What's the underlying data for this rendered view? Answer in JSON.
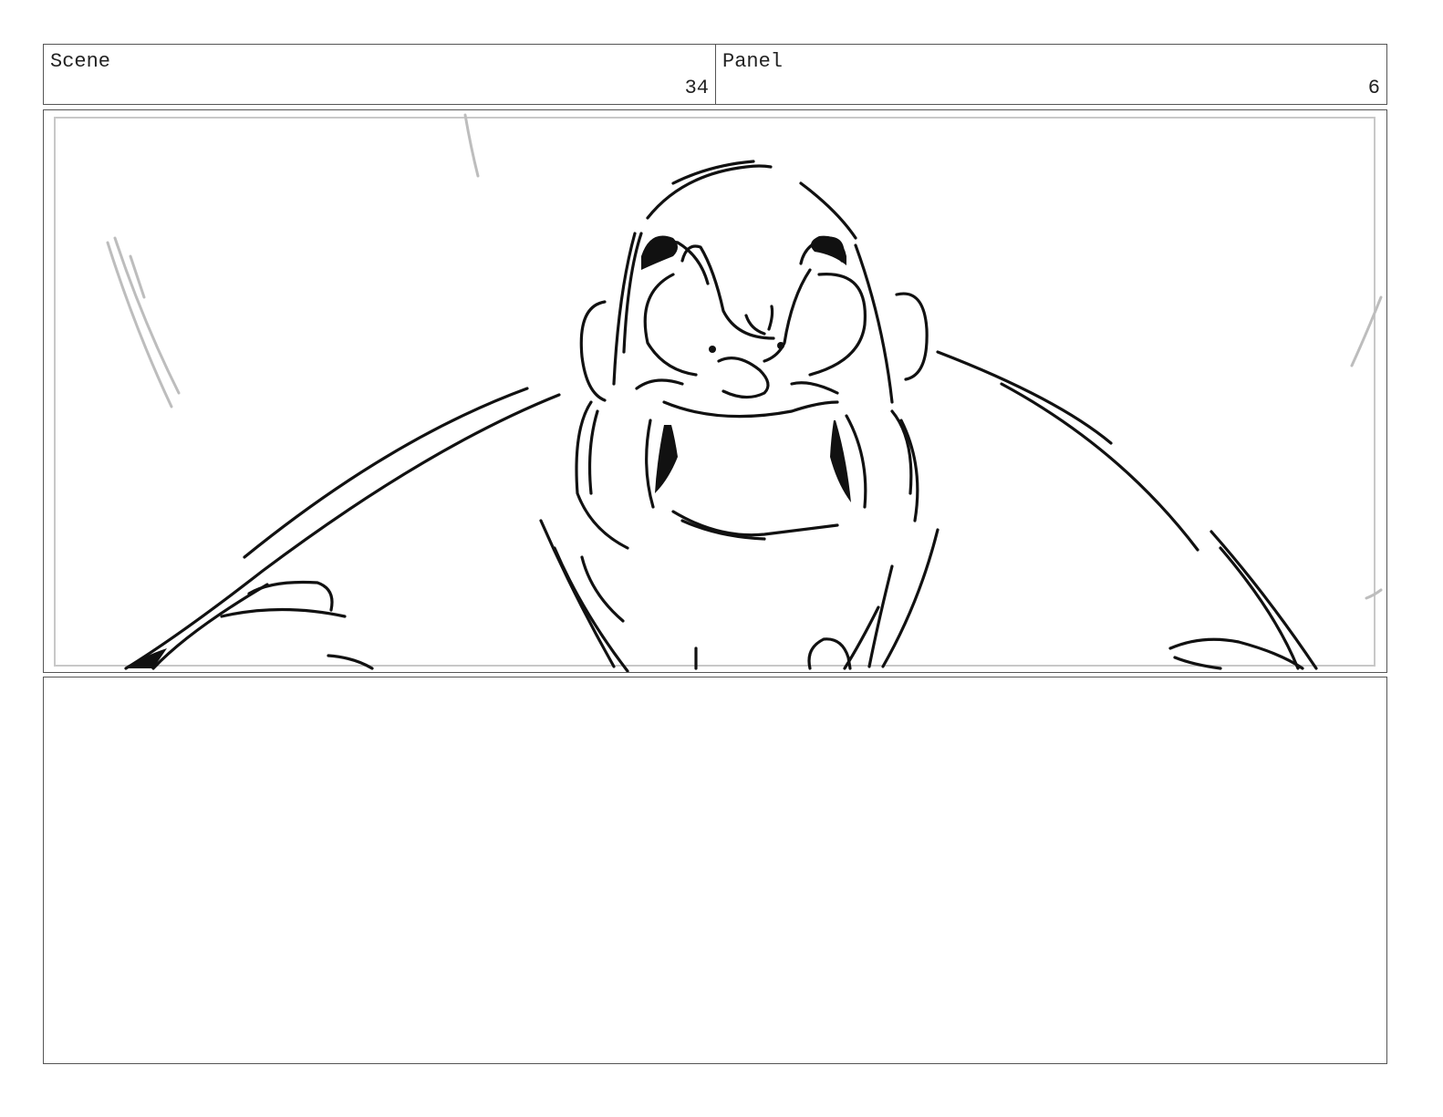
{
  "header": {
    "scene_label": "Scene",
    "scene_number": "34",
    "panel_label": "Panel",
    "panel_number": "6"
  },
  "frame": {
    "subject": "rough-sketch-angry-character",
    "line_color": "#111111",
    "guide_color": "#bdbdbd"
  },
  "notes": {
    "text": ""
  }
}
